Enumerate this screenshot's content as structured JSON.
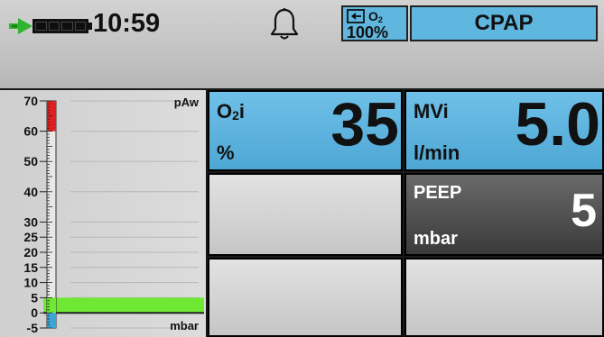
{
  "status_bar": {
    "time": "10:59",
    "battery_level_fraction": 1.0,
    "battery_icon": "battery-charging-icon",
    "alarm_icon": "bell-icon",
    "o2_label": "O",
    "o2_sub": "2",
    "o2_percent": "100%",
    "mode": "CPAP"
  },
  "pressure_bar": {
    "top_label": "pAw",
    "unit_label": "mbar",
    "scale_ticks": [
      "70",
      "60",
      "50",
      "40",
      "30",
      "25",
      "20",
      "15",
      "10",
      "5",
      "0",
      "-5"
    ],
    "current_pressure": 5,
    "scale_min": -5,
    "scale_max": 70,
    "alarm_zone_min": 60
  },
  "parameters": [
    {
      "id": "o2i",
      "name": "O",
      "sub": "2",
      "name_suffix": "i",
      "unit": "%",
      "value": "35"
    },
    {
      "id": "mvi",
      "name": "MVi",
      "sub": "",
      "name_suffix": "",
      "unit": "l/min",
      "value": "5.0"
    },
    {
      "id": "peep",
      "name": "PEEP",
      "sub": "",
      "name_suffix": "",
      "unit": "mbar",
      "value": "5"
    }
  ],
  "colors": {
    "accent_blue": "#5fb6df",
    "pressure_fill": "#6ee832",
    "alarm_red": "#e02020",
    "low_zone": "#3aa6d8"
  }
}
